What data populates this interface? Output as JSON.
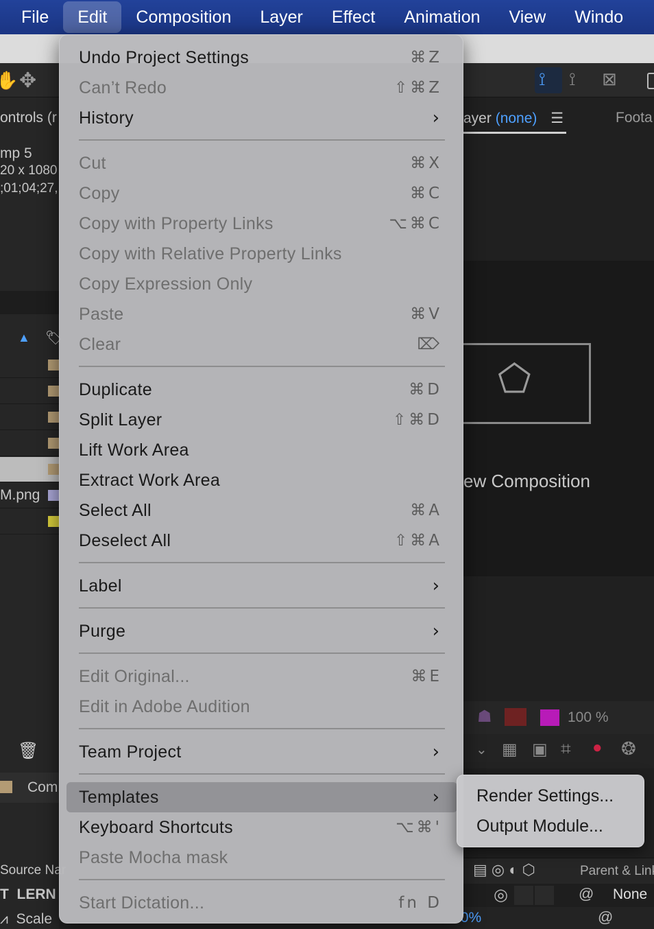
{
  "menubar": {
    "items": [
      "File",
      "Edit",
      "Composition",
      "Layer",
      "Effect",
      "Animation",
      "View",
      "Windo"
    ]
  },
  "background": {
    "controls_tab": "ontrols (r",
    "comp_name": "mp 5",
    "comp_dims": "20 x 1080",
    "comp_time": ";01;04;27,",
    "layer_tab_prefix": "ayer",
    "layer_tab_value": "(none)",
    "footage_tab": "Foota",
    "png_file": "M.png",
    "new_composition": "ew Composition",
    "zoom_percent": "100 %",
    "comp_tab": "Com",
    "source_name_header": "Source Nar",
    "parent_link_header": "Parent & Link",
    "layer_text": "LERN",
    "scale_label": "Scale",
    "parent_value": "None",
    "scale_value": ".0%"
  },
  "edit_menu": {
    "undo": {
      "label": "Undo Project Settings",
      "shortcut": "⌘Z"
    },
    "redo": {
      "label": "Can’t Redo",
      "shortcut": "⇧⌘Z"
    },
    "history": {
      "label": "History"
    },
    "cut": {
      "label": "Cut",
      "shortcut": "⌘X"
    },
    "copy": {
      "label": "Copy",
      "shortcut": "⌘C"
    },
    "copy_links": {
      "label": "Copy with Property Links",
      "shortcut": "⌥⌘C"
    },
    "copy_rel_links": {
      "label": "Copy with Relative Property Links"
    },
    "copy_expr": {
      "label": "Copy Expression Only"
    },
    "paste": {
      "label": "Paste",
      "shortcut": "⌘V"
    },
    "clear": {
      "label": "Clear",
      "shortcut": "⌦"
    },
    "duplicate": {
      "label": "Duplicate",
      "shortcut": "⌘D"
    },
    "split_layer": {
      "label": "Split Layer",
      "shortcut": "⇧⌘D"
    },
    "lift_work": {
      "label": "Lift Work Area"
    },
    "extract_work": {
      "label": "Extract Work Area"
    },
    "select_all": {
      "label": "Select All",
      "shortcut": "⌘A"
    },
    "deselect_all": {
      "label": "Deselect All",
      "shortcut": "⇧⌘A"
    },
    "label": {
      "label": "Label"
    },
    "purge": {
      "label": "Purge"
    },
    "edit_original": {
      "label": "Edit Original...",
      "shortcut": "⌘E"
    },
    "edit_audition": {
      "label": "Edit in Adobe Audition"
    },
    "team_project": {
      "label": "Team Project"
    },
    "templates": {
      "label": "Templates"
    },
    "keyboard_shortcuts": {
      "label": "Keyboard Shortcuts",
      "shortcut": "⌥⌘'"
    },
    "paste_mocha": {
      "label": "Paste Mocha mask"
    },
    "start_dictation": {
      "label": "Start Dictation...",
      "shortcut": "fn D"
    }
  },
  "templates_submenu": {
    "render_settings": "Render Settings...",
    "output_module": "Output Module..."
  },
  "colors": {
    "menubar": "#1b3583",
    "accent": "#4ea0ff",
    "menu_bg": "#b9b9bc"
  }
}
